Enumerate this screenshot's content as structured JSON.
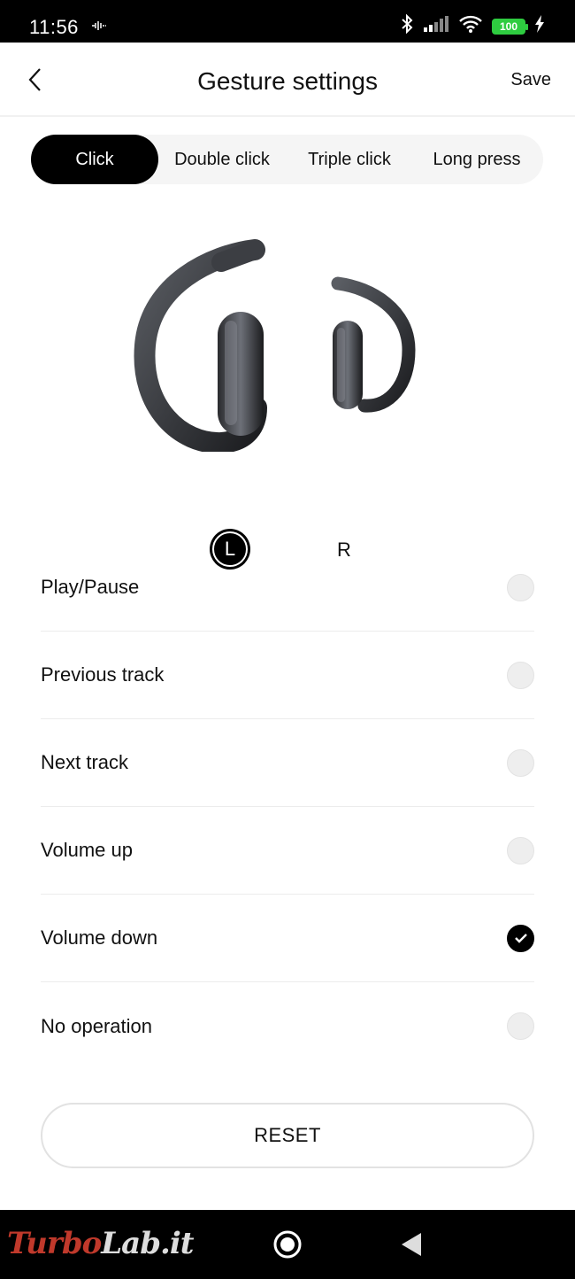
{
  "status_bar": {
    "time": "11:56",
    "battery_level": "100"
  },
  "header": {
    "title": "Gesture settings",
    "save_label": "Save"
  },
  "tabs": [
    {
      "label": "Click",
      "active": true
    },
    {
      "label": "Double click",
      "active": false
    },
    {
      "label": "Triple click",
      "active": false
    },
    {
      "label": "Long press",
      "active": false
    }
  ],
  "side_selector": {
    "left_label": "L",
    "right_label": "R",
    "selected": "L"
  },
  "options": [
    {
      "label": "Play/Pause",
      "checked": false
    },
    {
      "label": "Previous track",
      "checked": false
    },
    {
      "label": "Next track",
      "checked": false
    },
    {
      "label": "Volume up",
      "checked": false
    },
    {
      "label": "Volume down",
      "checked": true
    },
    {
      "label": "No operation",
      "checked": false
    }
  ],
  "reset_label": "RESET",
  "watermark": {
    "part1": "Turbo",
    "part2": "Lab.it"
  },
  "colors": {
    "accent": "#000000",
    "battery": "#2ecc40",
    "watermark": "#c0392b"
  }
}
